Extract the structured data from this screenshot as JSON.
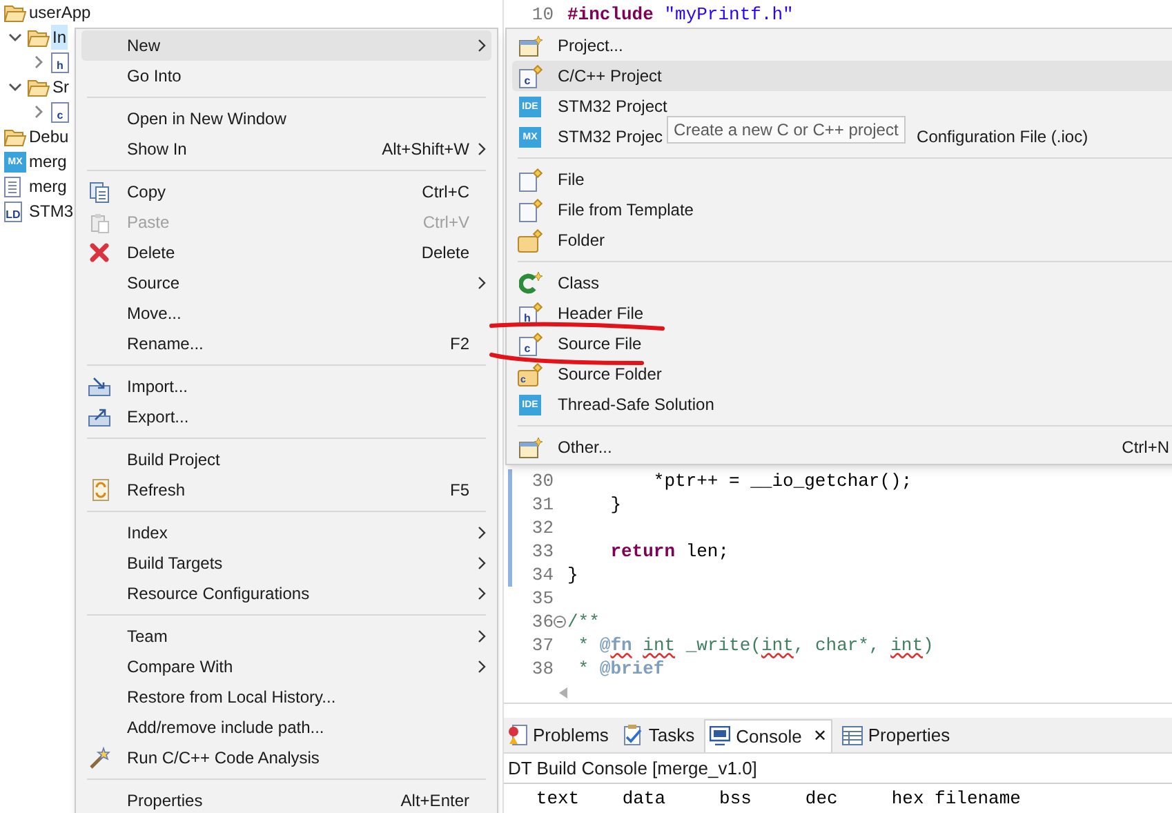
{
  "project_tree": [
    {
      "label": "userApp",
      "kind": "folder",
      "selected": false,
      "children": [
        {
          "label": "In",
          "kind": "folder",
          "expanded": true,
          "selected": true,
          "children": [
            {
              "kind": "file",
              "icon_text": "h",
              "expanded": false,
              "selected": false
            }
          ]
        },
        {
          "label": "Sr",
          "kind": "folder",
          "expanded": true,
          "selected": false,
          "children": [
            {
              "kind": "file",
              "icon_text": "c",
              "expanded": false,
              "selected": false
            }
          ]
        }
      ]
    },
    {
      "label": "Debu",
      "kind": "folder",
      "selected": false
    },
    {
      "label": "merg",
      "kind": "badge",
      "icon_text": "MX",
      "selected": false
    },
    {
      "label": "merg",
      "kind": "doc",
      "selected": false
    },
    {
      "label": "STM3",
      "kind": "file",
      "icon_text": "LD",
      "selected": false
    }
  ],
  "editor": {
    "lines_top": [
      {
        "number": "10",
        "tokens": [
          {
            "text": "#include",
            "kind": "keyword"
          },
          {
            "text": " \"myPrintf.h\"",
            "kind": "string"
          }
        ]
      }
    ],
    "lines": [
      {
        "number": "30",
        "changed": true,
        "tokens": [
          {
            "text": "        *ptr++ = __io_getchar();",
            "kind": "plain"
          }
        ]
      },
      {
        "number": "31",
        "changed": true,
        "tokens": [
          {
            "text": "    }",
            "kind": "plain"
          }
        ]
      },
      {
        "number": "32",
        "changed": true
      },
      {
        "number": "33",
        "changed": true,
        "tokens": [
          {
            "text": "    return",
            "kind": "keyword"
          },
          {
            "text": " len;",
            "kind": "plain"
          }
        ]
      },
      {
        "number": "34",
        "changed": true,
        "tokens": [
          {
            "text": "}",
            "kind": "plain"
          }
        ]
      },
      {
        "number": "35",
        "changed": false
      },
      {
        "number": "36",
        "changed": false,
        "folded": false,
        "tokens": [
          {
            "text": "/**",
            "kind": "comment"
          }
        ]
      },
      {
        "number": "37",
        "changed": false,
        "tokens": [
          {
            "text": " * ",
            "kind": "comment"
          },
          {
            "text": "@",
            "kind": "doctag"
          },
          {
            "text": "fn",
            "kind": "doctag",
            "misspelled": true
          },
          {
            "text": " int",
            "kind": "comment",
            "misspelled": true
          },
          {
            "text": " _write(",
            "kind": "comment"
          },
          {
            "text": "int",
            "kind": "comment",
            "misspelled": true
          },
          {
            "text": ", char*, ",
            "kind": "comment"
          },
          {
            "text": "int",
            "kind": "comment",
            "misspelled": true
          },
          {
            "text": ")",
            "kind": "comment"
          }
        ]
      },
      {
        "number": "38",
        "changed": false,
        "tokens": [
          {
            "text": " * ",
            "kind": "comment"
          },
          {
            "text": "@brief",
            "kind": "doctag"
          }
        ]
      }
    ]
  },
  "bottom_panel": {
    "tabs": [
      {
        "label": "Problems",
        "kind": "problems",
        "selected": false
      },
      {
        "label": "Tasks",
        "kind": "tasks",
        "selected": false
      },
      {
        "label": "Console",
        "kind": "console",
        "selected": true,
        "close": "✕"
      },
      {
        "label": "Properties",
        "kind": "properties",
        "selected": false
      }
    ],
    "console_title": "DT Build Console [merge_v1.0]",
    "console_lines": [
      "   text    data     bss     dec     hex filename"
    ]
  },
  "context_menu": {
    "groups": [
      [
        {
          "label": "New",
          "submenu": true,
          "selected": true,
          "disabled": false
        },
        {
          "label": "Go Into",
          "submenu": false,
          "selected": false,
          "disabled": false
        }
      ],
      [
        {
          "label": "Open in New Window",
          "submenu": false,
          "selected": false,
          "disabled": false
        },
        {
          "label": "Show In",
          "shortcut": "Alt+Shift+W",
          "submenu": true,
          "selected": false,
          "disabled": false
        }
      ],
      [
        {
          "label": "Copy",
          "kind": "copy",
          "shortcut": "Ctrl+C",
          "submenu": false,
          "selected": false,
          "disabled": false
        },
        {
          "label": "Paste",
          "kind": "paste",
          "shortcut": "Ctrl+V",
          "submenu": false,
          "selected": false,
          "disabled": true
        },
        {
          "label": "Delete",
          "kind": "delete",
          "shortcut": "Delete",
          "submenu": false,
          "selected": false,
          "disabled": false
        },
        {
          "label": "Source",
          "submenu": true,
          "selected": false,
          "disabled": false
        },
        {
          "label": "Move...",
          "submenu": false,
          "selected": false,
          "disabled": false
        },
        {
          "label": "Rename...",
          "shortcut": "F2",
          "submenu": false,
          "selected": false,
          "disabled": false
        }
      ],
      [
        {
          "label": "Import...",
          "kind": "import",
          "submenu": false,
          "selected": false,
          "disabled": false
        },
        {
          "label": "Export...",
          "kind": "export",
          "submenu": false,
          "selected": false,
          "disabled": false
        }
      ],
      [
        {
          "label": "Build Project",
          "submenu": false,
          "selected": false,
          "disabled": false
        },
        {
          "label": "Refresh",
          "kind": "refresh",
          "shortcut": "F5",
          "submenu": false,
          "selected": false,
          "disabled": false
        }
      ],
      [
        {
          "label": "Index",
          "submenu": true,
          "selected": false,
          "disabled": false
        },
        {
          "label": "Build Targets",
          "submenu": true,
          "selected": false,
          "disabled": false
        },
        {
          "label": "Resource Configurations",
          "submenu": true,
          "selected": false,
          "disabled": false
        }
      ],
      [
        {
          "label": "Team",
          "submenu": true,
          "selected": false,
          "disabled": false
        },
        {
          "label": "Compare With",
          "submenu": true,
          "selected": false,
          "disabled": false
        },
        {
          "label": "Restore from Local History...",
          "submenu": false,
          "selected": false,
          "disabled": false
        },
        {
          "label": "Add/remove include path...",
          "submenu": false,
          "selected": false,
          "disabled": false
        },
        {
          "label": "Run C/C++ Code Analysis",
          "kind": "wand",
          "submenu": false,
          "selected": false,
          "disabled": false
        }
      ],
      [
        {
          "label": "Properties",
          "shortcut": "Alt+Enter",
          "submenu": false,
          "selected": false,
          "disabled": false
        }
      ]
    ]
  },
  "new_submenu": {
    "groups": [
      [
        {
          "label": "Project...",
          "kind": "project",
          "selected": false
        },
        {
          "label": "C/C++ Project",
          "kind": "file-new",
          "icon_text": "c",
          "selected": true
        },
        {
          "label": "STM32 Project",
          "kind": "badge",
          "icon_text": "IDE",
          "selected": false
        },
        {
          "label": "STM32 Projec",
          "label_tail": "Configuration File (.ioc)",
          "kind": "badge",
          "icon_text": "MX",
          "selected": false
        }
      ],
      [
        {
          "label": "File",
          "kind": "file-new",
          "selected": false
        },
        {
          "label": "File from Template",
          "kind": "file-new",
          "selected": false
        },
        {
          "label": "Folder",
          "kind": "folder-new",
          "selected": false
        }
      ],
      [
        {
          "label": "Class",
          "kind": "class",
          "selected": false
        },
        {
          "label": "Header File",
          "kind": "file-new",
          "icon_text": "h",
          "selected": false
        },
        {
          "label": "Source File",
          "kind": "file-new",
          "icon_text": "c",
          "selected": false
        },
        {
          "label": "Source Folder",
          "kind": "folder-new",
          "icon_text": "c",
          "selected": false
        },
        {
          "label": "Thread-Safe Solution",
          "kind": "badge",
          "icon_text": "IDE",
          "selected": false
        }
      ],
      [
        {
          "label": "Other...",
          "kind": "project",
          "shortcut": "Ctrl+N",
          "selected": false
        }
      ]
    ],
    "tooltip": "Create a new C or C++ project"
  }
}
